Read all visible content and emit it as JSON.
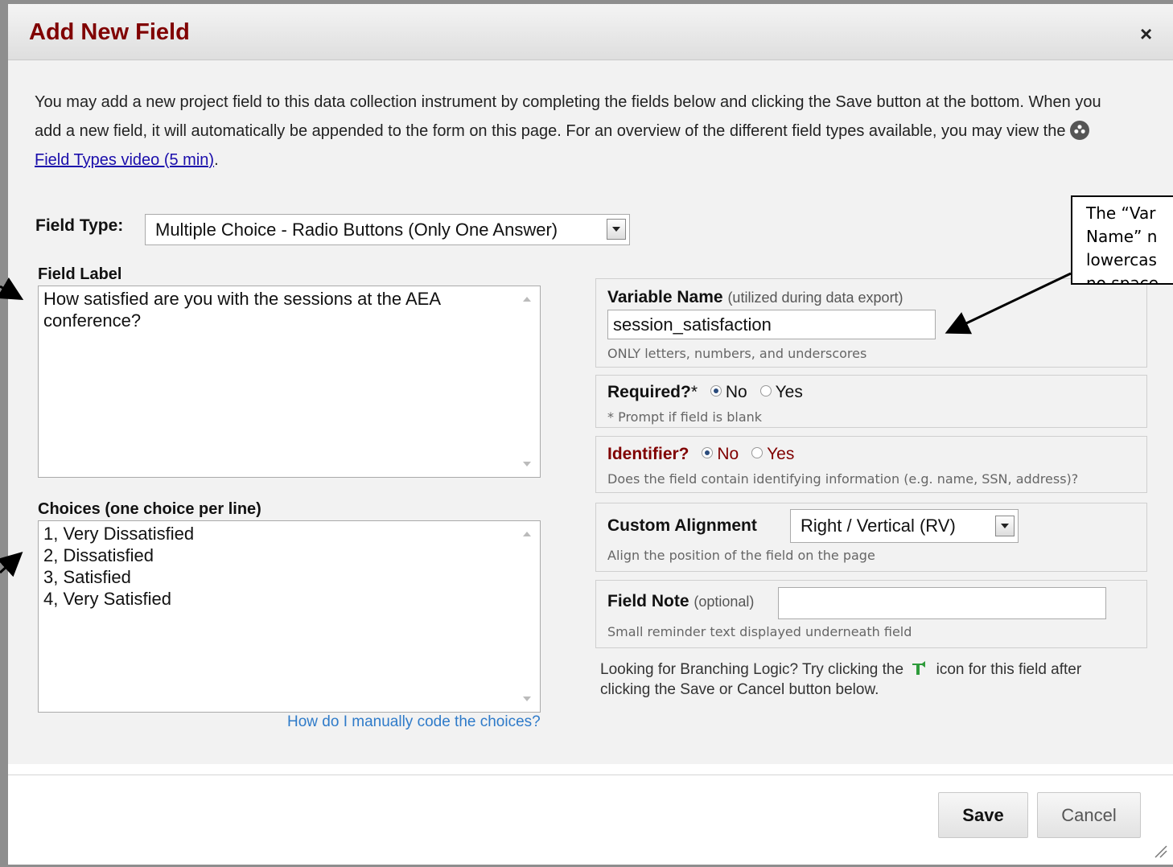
{
  "dialog": {
    "title": "Add New Field",
    "close_label": "×",
    "intro_text": "You may add a new project field to this data collection instrument by completing the fields below and clicking the Save button at the bottom. When you add a new field, it will automatically be appended to the form on this page. For an overview of the different field types available, you may view the",
    "video_link": "Field Types video (5 min)",
    "intro_end": "."
  },
  "field_type": {
    "label": "Field Type:",
    "value": "Multiple Choice - Radio Buttons (Only One Answer)"
  },
  "field_label": {
    "label": "Field Label",
    "value": "How satisfied are you with the sessions at the AEA\nconference?"
  },
  "choices": {
    "label": "Choices (one choice per line)",
    "value": "1, Very Dissatisfied\n2, Dissatisfied\n3, Satisfied\n4, Very Satisfied",
    "help_link": "How do I manually code the choices?"
  },
  "variable_name": {
    "label": "Variable Name",
    "sublabel": "(utilized during data export)",
    "value": "session_satisfaction",
    "note": "ONLY letters, numbers, and underscores"
  },
  "required": {
    "label": "Required?",
    "asterisk": "*",
    "option_no": "No",
    "option_yes": "Yes",
    "selected": "No",
    "note": "* Prompt if field is blank"
  },
  "identifier": {
    "label": "Identifier?",
    "option_no": "No",
    "option_yes": "Yes",
    "selected": "No",
    "note": "Does the field contain identifying information (e.g. name, SSN, address)?"
  },
  "alignment": {
    "label": "Custom Alignment",
    "value": "Right / Vertical (RV)",
    "note": "Align the position of the field on the page"
  },
  "field_note": {
    "label": "Field Note",
    "sublabel": "(optional)",
    "value": "",
    "note": "Small reminder text displayed underneath field"
  },
  "branching_hint": {
    "before": "Looking for Branching Logic? Try clicking the",
    "after": "icon for this field after clicking the Save or Cancel button below."
  },
  "buttons": {
    "save": "Save",
    "cancel": "Cancel"
  },
  "callout": {
    "text": "The “Var\nName” n\nlowercas\nno space"
  },
  "colors": {
    "title": "#800000",
    "link": "#2f7bc9",
    "body_bg": "#f2f2f2"
  }
}
